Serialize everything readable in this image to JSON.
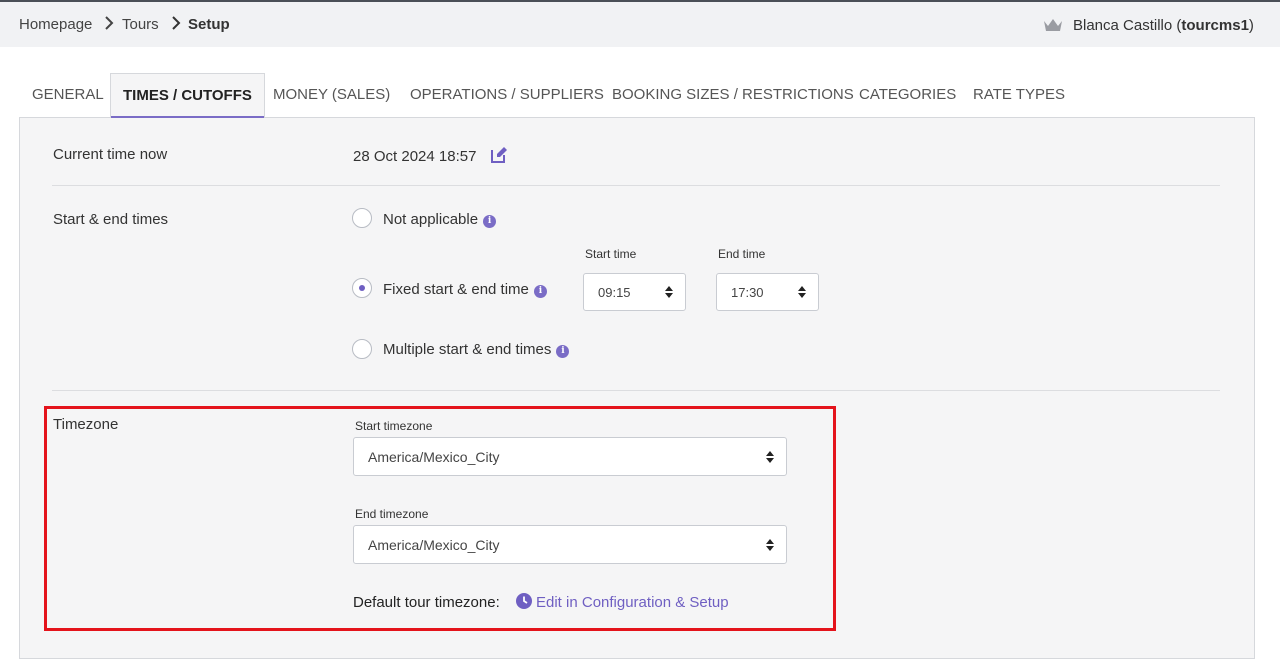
{
  "breadcrumb": {
    "home": "Homepage",
    "tours": "Tours",
    "current": "Setup"
  },
  "user": {
    "name": "Blanca Castillo (",
    "account": "tourcms1",
    "close": ")"
  },
  "tabs": [
    "GENERAL",
    "TIMES / CUTOFFS",
    "MONEY (SALES)",
    "OPERATIONS / SUPPLIERS",
    "BOOKING SIZES / RESTRICTIONS",
    "CATEGORIES",
    "RATE TYPES"
  ],
  "active_tab": "TIMES / CUTOFFS",
  "current_time": {
    "label": "Current time now",
    "value": "28 Oct 2024 18:57"
  },
  "start_end": {
    "label": "Start & end times",
    "options": [
      "Not applicable",
      "Fixed start & end time",
      "Multiple start & end times"
    ],
    "selected": "Fixed start & end time",
    "start_time_label": "Start time",
    "start_time": "09:15",
    "end_time_label": "End time",
    "end_time": "17:30"
  },
  "timezone": {
    "label": "Timezone",
    "start_label": "Start timezone",
    "start_value": "America/Mexico_City",
    "end_label": "End timezone",
    "end_value": "America/Mexico_City",
    "default_label": "Default tour timezone:",
    "edit_link": "Edit in Configuration & Setup"
  },
  "colors": {
    "accent": "#6f5fc2",
    "highlight": "#e4131b"
  },
  "icons": [
    "chevron-right-icon",
    "crown-icon",
    "edit-icon",
    "info-icon",
    "sort-arrows-icon",
    "clock-icon"
  ]
}
